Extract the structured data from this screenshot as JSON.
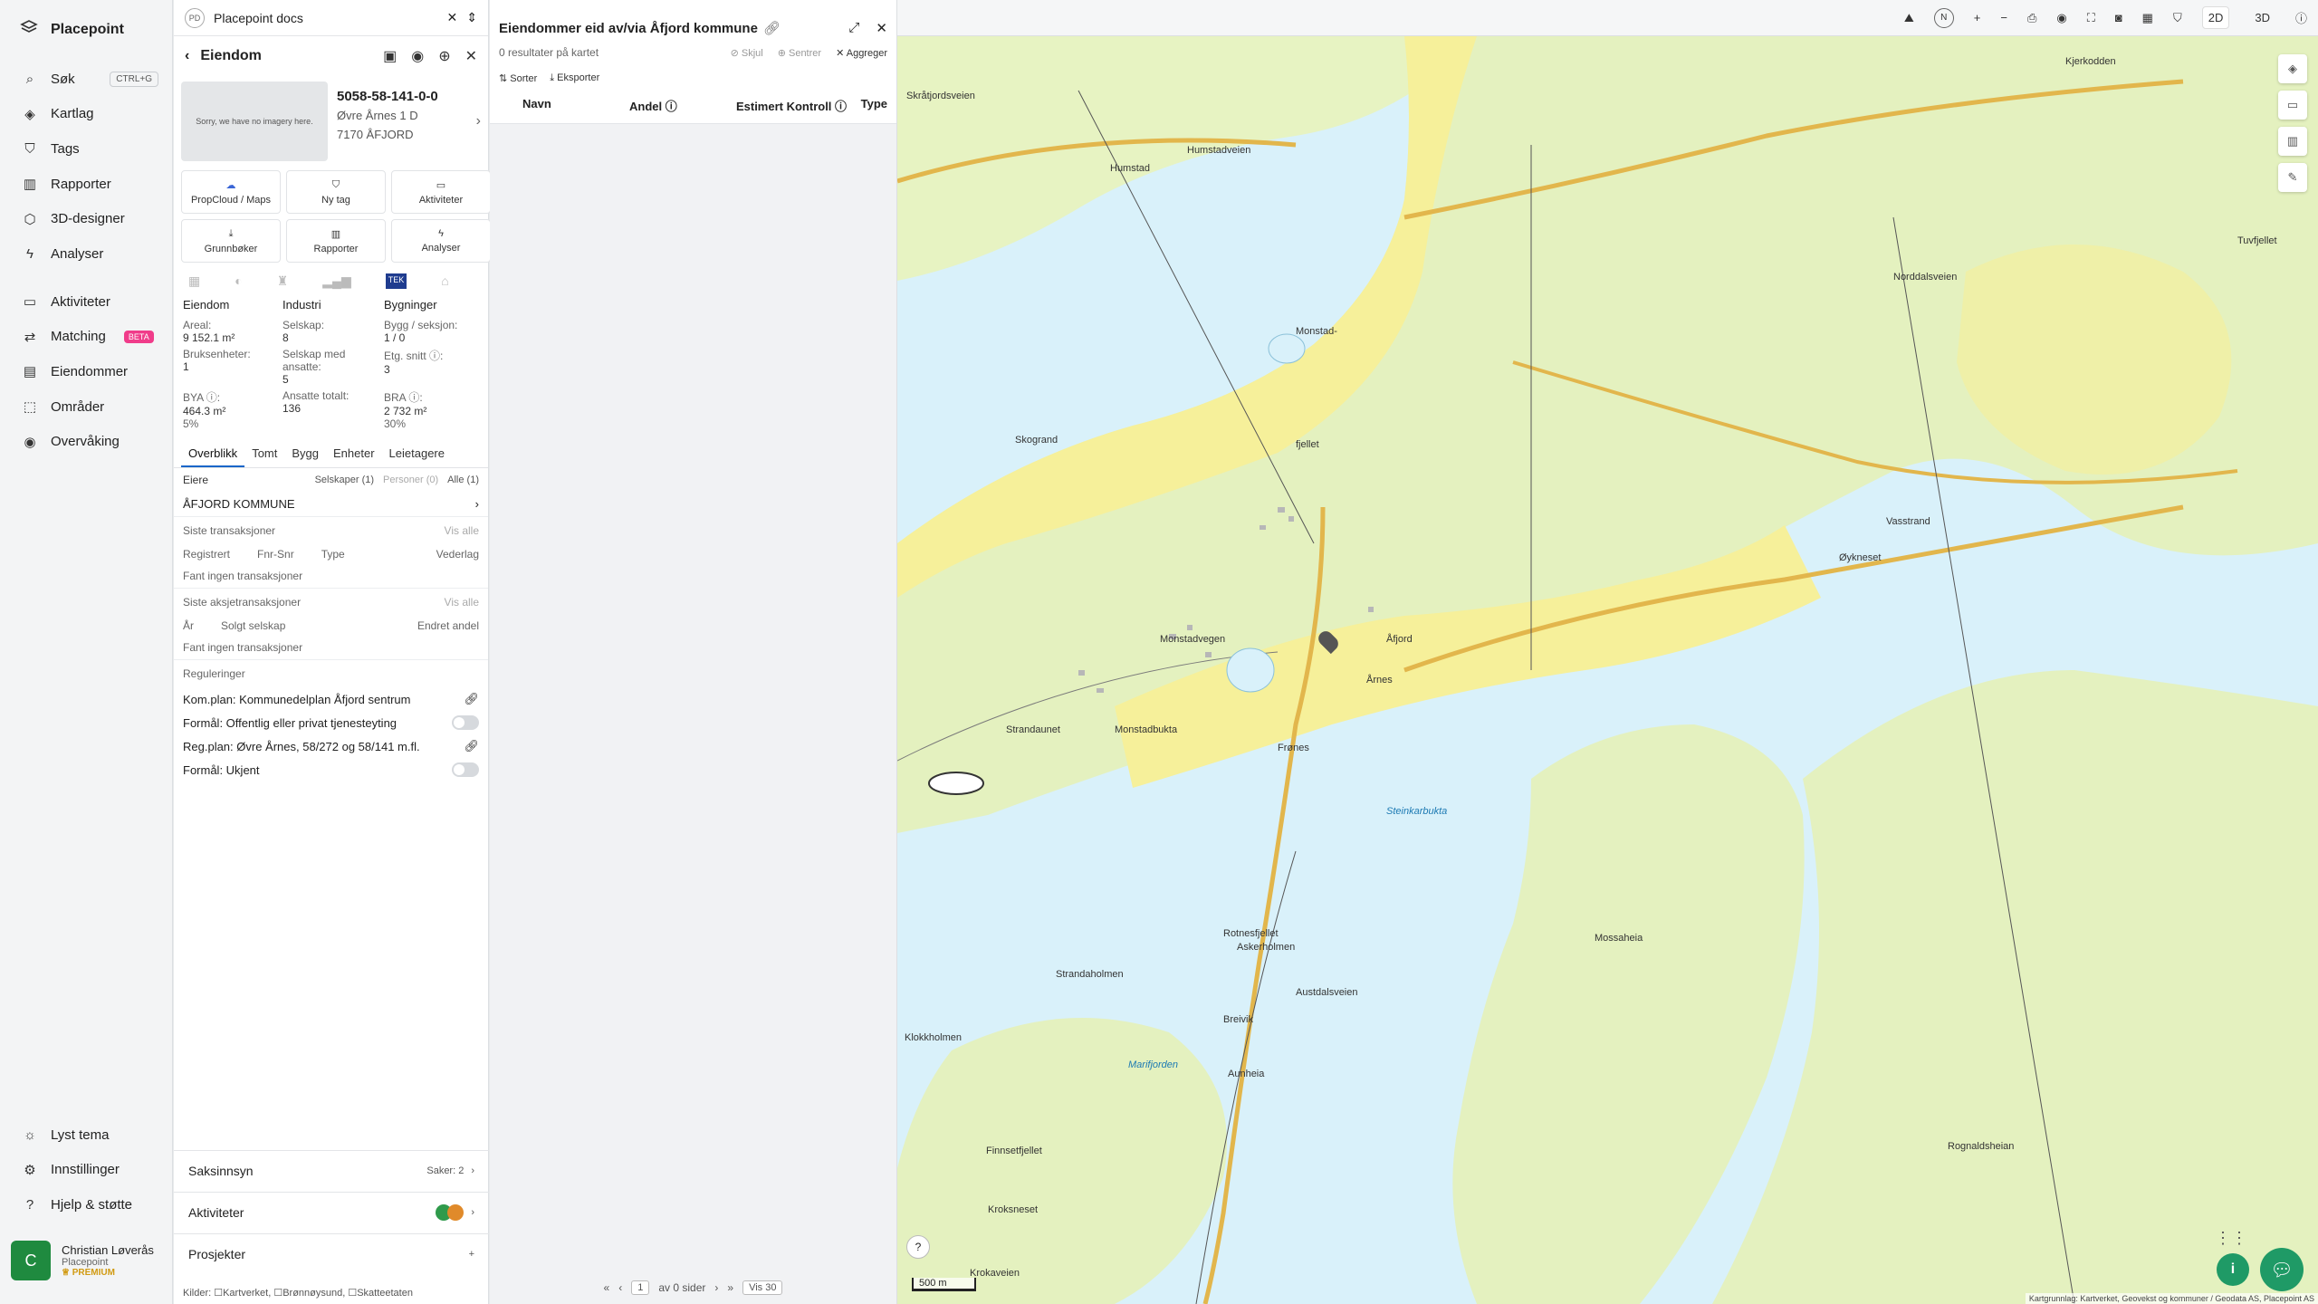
{
  "app": {
    "name": "Placepoint"
  },
  "nav": {
    "items": [
      {
        "label": "Søk",
        "icon": "search-icon",
        "kbd": "CTRL+G"
      },
      {
        "label": "Kartlag",
        "icon": "layers-icon"
      },
      {
        "label": "Tags",
        "icon": "bookmark-icon"
      },
      {
        "label": "Rapporter",
        "icon": "chart-icon"
      },
      {
        "label": "3D-designer",
        "icon": "cube-icon"
      },
      {
        "label": "Analyser",
        "icon": "bolt-icon"
      },
      {
        "label": "Aktiviteter",
        "icon": "chat-icon"
      },
      {
        "label": "Matching",
        "icon": "match-icon",
        "badge": "BETA"
      },
      {
        "label": "Eiendommer",
        "icon": "building-icon"
      },
      {
        "label": "Områder",
        "icon": "area-icon"
      },
      {
        "label": "Overvåking",
        "icon": "eye-icon"
      }
    ],
    "bottom": [
      {
        "label": "Lyst tema",
        "icon": "sun-icon"
      },
      {
        "label": "Innstillinger",
        "icon": "gear-icon"
      },
      {
        "label": "Hjelp & støtte",
        "icon": "help-icon"
      }
    ]
  },
  "user": {
    "initial": "C",
    "name": "Christian Løverås",
    "org": "Placepoint",
    "plan": "PREMIUM"
  },
  "docs": {
    "badge": "PD",
    "title": "Placepoint docs"
  },
  "property_panel": {
    "title": "Eiendom",
    "image_text": "Sorry, we have no imagery here.",
    "id": "5058-58-141-0-0",
    "address1": "Øvre Årnes 1 D",
    "address2": "7170 ÅFJORD",
    "buttons": [
      "PropCloud / Maps",
      "Ny tag",
      "Aktiviteter",
      "Grunnbøker",
      "Rapporter",
      "Analyser"
    ],
    "stats": {
      "col1_title": "Eiendom",
      "col2_title": "Industri",
      "col3_title": "Bygninger",
      "areal_label": "Areal:",
      "areal_value": "9 152.1 m²",
      "bruks_label": "Bruksenheter:",
      "bruks_value": "1",
      "bya_label": "BYA ⓘ:",
      "bya_value": "464.3 m²",
      "bya_pct": "5%",
      "selskap_label": "Selskap:",
      "selskap_value": "8",
      "ansatte_label": "Selskap med ansatte:",
      "ansatte_value": "5",
      "ansatte_tot_label": "Ansatte totalt:",
      "ansatte_tot_value": "136",
      "bygg_label": "Bygg / seksjon:",
      "bygg_value": "1 / 0",
      "etg_label": "Etg. snitt ⓘ:",
      "etg_value": "3",
      "bra_label": "BRA ⓘ:",
      "bra_value": "2 732 m²",
      "bra_pct": "30%"
    },
    "tabs": [
      "Overblikk",
      "Tomt",
      "Bygg",
      "Enheter",
      "Leietagere"
    ],
    "owners_label": "Eiere",
    "owners_chips": [
      "Selskaper (1)",
      "Personer (0)",
      "Alle (1)"
    ],
    "owner": "ÅFJORD KOMMUNE",
    "transactions_title": "Siste transaksjoner",
    "vis_alle": "Vis alle",
    "trans_cols": [
      "Registrert",
      "Fnr-Snr",
      "Type",
      "Vederlag"
    ],
    "trans_empty": "Fant ingen transaksjoner",
    "share_title": "Siste aksjetransaksjoner",
    "share_cols": [
      "År",
      "Solgt selskap",
      "Endret andel"
    ],
    "share_empty": "Fant ingen transaksjoner",
    "reg_title": "Reguleringer",
    "regs": [
      "Kom.plan: Kommunedelplan Åfjord sentrum",
      "Formål: Offentlig eller privat tjenesteyting",
      "Reg.plan: Øvre Årnes, 58/272 og 58/141 m.fl.",
      "Formål: Ukjent"
    ],
    "sections": [
      {
        "label": "Saksinnsyn",
        "right": "Saker: 2"
      },
      {
        "label": "Aktiviteter",
        "right": ""
      },
      {
        "label": "Prosjekter",
        "right": "+"
      }
    ],
    "kilder": "Kilder: ☐Kartverket, ☐Brønnøysund, ☐Skatteetaten"
  },
  "list_panel": {
    "title": "Eiendommer eid av/via Åfjord kommune",
    "results": "0 resultater på kartet",
    "skjul": "Skjul",
    "sentrer": "Sentrer",
    "aggreger": "Aggreger",
    "sorter": "Sorter",
    "eksporter": "Eksporter",
    "cols": [
      "Navn",
      "Andel ⓘ",
      "Estimert Kontroll ⓘ",
      "Type"
    ],
    "pager": {
      "page": "1",
      "of": "av 0 sider",
      "per": "Vis 30"
    }
  },
  "map": {
    "modes": [
      "2D",
      "3D"
    ],
    "scale": "500 m",
    "attribution": "Kartgrunnlag: Kartverket, Geovekst og kommuner / Geodata AS, Placepoint AS",
    "labels": [
      "Skråtjordsveien",
      "Humstadveien",
      "Norddalsveien",
      "Monstad-",
      "fjellet",
      "Monstadvegen",
      "Monstadbukta",
      "Åfjord",
      "Årnes",
      "Austdalsveien",
      "Marifjorden",
      "Krokaveien",
      "Vasstrand",
      "Strandaunet",
      "Frønes",
      "Rotnesfjellet",
      "Aunheia",
      "Breivik",
      "Mossaheia",
      "Rognaldsheian",
      "Tuvfjellet",
      "Øykneset",
      "Strandaholmen",
      "Askerholmen",
      "Klokkholmen",
      "Finnsetfjellet",
      "Kroksneset",
      "Humstad",
      "Skogrand",
      "Kjerkodden",
      "Steinkarbukta"
    ]
  },
  "colors": {
    "accent": "#1a66c9",
    "brand_green": "#1f8a3f",
    "beta": "#f03c8a"
  }
}
